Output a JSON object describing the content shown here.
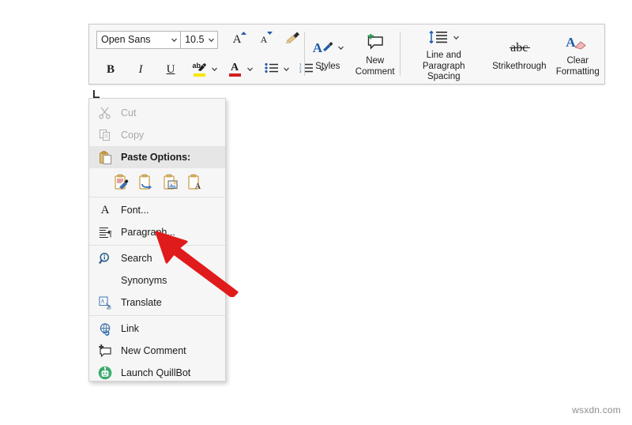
{
  "colors": {
    "toolbar_bg": "#f7f7f7",
    "toolbar_border": "#c8c8c8",
    "menu_bg": "#f6f6f6",
    "menu_border": "#d3d3d3",
    "paste_header_bg": "#e6e6e6",
    "accent_blue": "#1f5aa8",
    "highlight_yellow": "#f7e600",
    "font_color_red": "#d02020",
    "arrow_red": "#e01b1b",
    "quillbot_green": "#3cab6e",
    "disabled_text": "#a8a8a8"
  },
  "mini_toolbar": {
    "font_name": {
      "value": "Open Sans",
      "caret_icon": "chevron-down-icon"
    },
    "font_size": {
      "value": "10.5",
      "caret_icon": "chevron-down-icon"
    },
    "grow_font": {
      "label": "A",
      "icon": "grow-font-icon"
    },
    "shrink_font": {
      "label": "A",
      "icon": "shrink-font-icon"
    },
    "format_painter": {
      "icon": "format-painter-icon"
    },
    "bold": {
      "label": "B",
      "icon": "bold-icon"
    },
    "italic": {
      "label": "I",
      "icon": "italic-icon"
    },
    "underline": {
      "label": "U",
      "icon": "underline-icon"
    },
    "highlight": {
      "label": "ab",
      "icon": "text-highlight-color-icon"
    },
    "font_color": {
      "label": "A",
      "icon": "font-color-icon"
    },
    "bullets": {
      "icon": "bullet-list-icon"
    },
    "numbering": {
      "icon": "numbered-list-icon"
    },
    "styles": {
      "label": "Styles",
      "icon": "styles-icon"
    },
    "new_comment": {
      "label": "New\nComment",
      "line1": "New",
      "line2": "Comment",
      "icon": "new-comment-icon"
    },
    "line_spacing": {
      "label": "Line and Paragraph Spacing",
      "line1": "Line and Paragraph",
      "line2": "Spacing",
      "icon": "line-and-paragraph-spacing-icon"
    },
    "strikethrough": {
      "label": "Strikethrough",
      "icon": "strikethrough-icon",
      "glyph": "abc"
    },
    "clear_formatting": {
      "label": "Clear Formatting",
      "line1": "Clear",
      "line2": "Formatting",
      "icon": "clear-formatting-icon"
    }
  },
  "context_menu": {
    "items": [
      {
        "key": "cut",
        "label": "Cut",
        "icon": "scissors-icon",
        "disabled": true,
        "submenu": false
      },
      {
        "key": "copy",
        "label": "Copy",
        "icon": "copy-icon",
        "disabled": true,
        "submenu": false
      },
      {
        "key": "paste",
        "label": "Paste Options:",
        "icon": "clipboard-icon",
        "disabled": false,
        "submenu": false
      },
      {
        "key": "font",
        "label": "Font...",
        "icon": "font-icon",
        "disabled": false,
        "submenu": false
      },
      {
        "key": "paragraph",
        "label": "Paragraph...",
        "icon": "paragraph-icon",
        "disabled": false,
        "submenu": false
      },
      {
        "key": "search",
        "label": "Search",
        "icon": "search-icon",
        "disabled": false,
        "submenu": false
      },
      {
        "key": "synonyms",
        "label": "Synonyms",
        "icon": "none",
        "disabled": false,
        "submenu": true
      },
      {
        "key": "translate",
        "label": "Translate",
        "icon": "translate-icon",
        "disabled": false,
        "submenu": false
      },
      {
        "key": "link",
        "label": "Link",
        "icon": "link-globe-icon",
        "disabled": false,
        "submenu": false
      },
      {
        "key": "newcomment",
        "label": "New Comment",
        "icon": "new-comment-icon",
        "disabled": false,
        "submenu": false
      },
      {
        "key": "quillbot",
        "label": "Launch QuillBot",
        "icon": "quillbot-icon",
        "disabled": false,
        "submenu": false
      }
    ],
    "paste_options": [
      {
        "key": "keep-source-formatting",
        "tooltip": "Keep Source Formatting",
        "icon": "paste-keep-source-formatting-icon"
      },
      {
        "key": "merge-formatting",
        "tooltip": "Merge Formatting",
        "icon": "paste-merge-formatting-icon"
      },
      {
        "key": "picture",
        "tooltip": "Picture",
        "icon": "paste-picture-icon"
      },
      {
        "key": "keep-text-only",
        "tooltip": "Keep Text Only",
        "icon": "paste-keep-text-only-icon"
      }
    ],
    "submenu_arrow": "▶"
  },
  "annotation": {
    "arrow": {
      "name": "red-pointer-arrow",
      "points_to": "Paragraph..."
    }
  },
  "watermark": {
    "text": "wsxdn.com"
  }
}
